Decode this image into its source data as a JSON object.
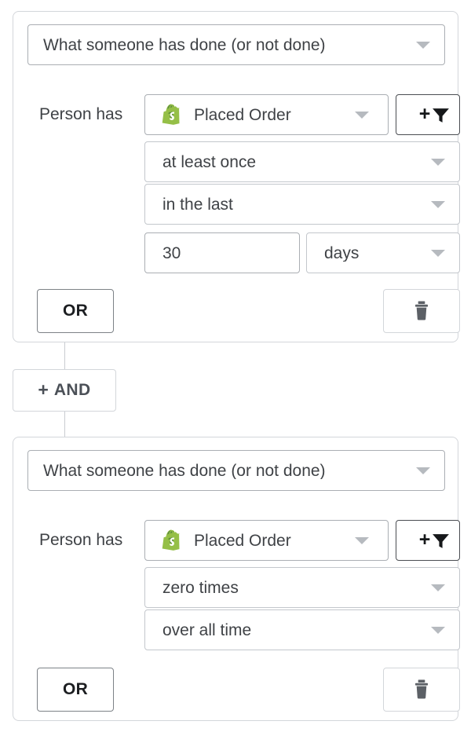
{
  "groups": [
    {
      "trigger": {
        "label": "What someone has done (or not done)",
        "caret_icon": "chevron-down-icon"
      },
      "person_label": "Person has",
      "metric": {
        "label": "Placed Order",
        "icon": "shopify-icon",
        "caret_icon": "chevron-down-icon"
      },
      "add_filter": {
        "plus": "+",
        "icon": "filter-funnel-icon"
      },
      "frequency": {
        "label": "at least once",
        "caret_icon": "chevron-down-icon"
      },
      "timeframe": {
        "label": "in the last",
        "caret_icon": "chevron-down-icon"
      },
      "amount": {
        "value": "30"
      },
      "unit": {
        "label": "days",
        "caret_icon": "chevron-down-icon"
      },
      "or_label": "OR",
      "delete_icon": "trash-icon"
    },
    {
      "trigger": {
        "label": "What someone has done (or not done)",
        "caret_icon": "chevron-down-icon"
      },
      "person_label": "Person has",
      "metric": {
        "label": "Placed Order",
        "icon": "shopify-icon",
        "caret_icon": "chevron-down-icon"
      },
      "add_filter": {
        "plus": "+",
        "icon": "filter-funnel-icon"
      },
      "frequency": {
        "label": "zero times",
        "caret_icon": "chevron-down-icon"
      },
      "timeframe": {
        "label": "over all time",
        "caret_icon": "chevron-down-icon"
      },
      "or_label": "OR",
      "delete_icon": "trash-icon"
    }
  ],
  "and_connector": {
    "plus": "+",
    "label": "AND"
  },
  "colors": {
    "card_border": "#d3d6da",
    "field_border": "#aaaeb3",
    "text": "#3f4246",
    "caret": "#b6babf",
    "shopify_green": "#95bf47",
    "shopify_green_dark": "#5e8e3e",
    "trash": "#5c6066",
    "and_text": "#4b5057"
  }
}
